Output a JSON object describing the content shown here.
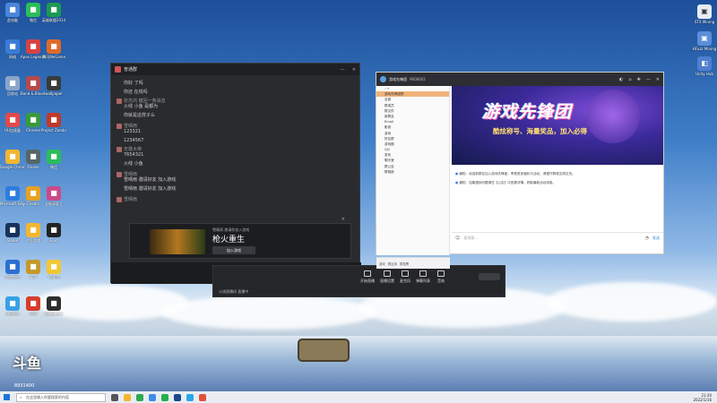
{
  "desktop": {
    "icons": [
      {
        "label": "此电脑"
      },
      {
        "label": "微信"
      },
      {
        "label": "英雄联盟2014"
      },
      {
        "label": "网络"
      },
      {
        "label": "Apex Legends"
      },
      {
        "label": "腾讯WeGame"
      },
      {
        "label": "回收站"
      },
      {
        "label": "Band & Blood Beta"
      },
      {
        "label": "wallpaper"
      },
      {
        "label": "UU加速器"
      },
      {
        "label": "Chrome"
      },
      {
        "label": "Project Zomboid"
      },
      {
        "label": "Google Chrome"
      },
      {
        "label": "Frozen"
      },
      {
        "label": "微信"
      },
      {
        "label": "Microsoft Edge"
      },
      {
        "label": "Cheats"
      },
      {
        "label": "全能录屏王"
      },
      {
        "label": "Steam"
      },
      {
        "label": "对号游戏"
      },
      {
        "label": "Epic"
      },
      {
        "label": "游戏加加"
      },
      {
        "label": "学习"
      },
      {
        "label": "YY语音"
      },
      {
        "label": "QQ游戏"
      },
      {
        "label": "迅游"
      },
      {
        "label": "Wallpaper"
      }
    ],
    "right_icons": [
      {
        "label": "STX Mining"
      },
      {
        "label": "HFuzz Mining"
      },
      {
        "label": "Unity Hub"
      }
    ],
    "watermark": "斗鱼",
    "room": "8931400"
  },
  "chat_window": {
    "title": "普通群",
    "messages": [
      {
        "text": "你好 了吗"
      },
      {
        "text": "你还 在线吗"
      },
      {
        "who": "张杰鸿 撤回一条消息",
        "text": "火线 小鱼 是都为"
      },
      {
        "text": "你就是这样子么"
      },
      {
        "who": "雪晴雨",
        "text": "123321"
      },
      {
        "text": "1234567"
      },
      {
        "who": "无尊大帝",
        "text": "7654321"
      },
      {
        "text": "火线 小鱼"
      },
      {
        "who": "雪晴雨",
        "text": "雪晴雨 邀请好友 加入游戏"
      },
      {
        "text": "雪晴雨 邀请好友 加入游戏"
      },
      {
        "who": "雪晴雨",
        "text": ""
      }
    ],
    "card": {
      "invite": "雪晴雨 邀请你加入游戏",
      "game": "枪火重生",
      "join_label": "加入游戏"
    }
  },
  "stream_bar": {
    "buttons": [
      "开始直播",
      "直播设置",
      "麦克风",
      "弹幕列表",
      "音效"
    ],
    "status": "火线直播间 直播中"
  },
  "qq_window": {
    "title": "游戏先锋团",
    "id": "9606602",
    "side_items": [
      "全部",
      "群成员",
      "群文件",
      "新群友",
      "Email",
      "影音",
      "游戏",
      "好友群",
      "游戏圈",
      "QQ",
      "发布",
      "聊天室",
      "群公告",
      "群相册"
    ],
    "side_selected": "游戏先锋团群",
    "banner_title": "游戏先锋团",
    "banner_sub": "酷炫称号、海量奖品，加入必得",
    "notices": [
      "通知：欢迎新群友加入游戏先锋团，享受更多福利与活动，请遵守群规文明交流。",
      "通知：如果遇到问题请在【公告】中查看详情，获取最新活动消息。"
    ],
    "input_placeholder": "发消息...",
    "send_label": "发送",
    "bottom": [
      "游戏",
      "群应用",
      "群投票"
    ]
  },
  "taskbar": {
    "search_placeholder": "在这里输入你要搜索的内容",
    "time": "21:30",
    "date": "2022/1/16"
  }
}
